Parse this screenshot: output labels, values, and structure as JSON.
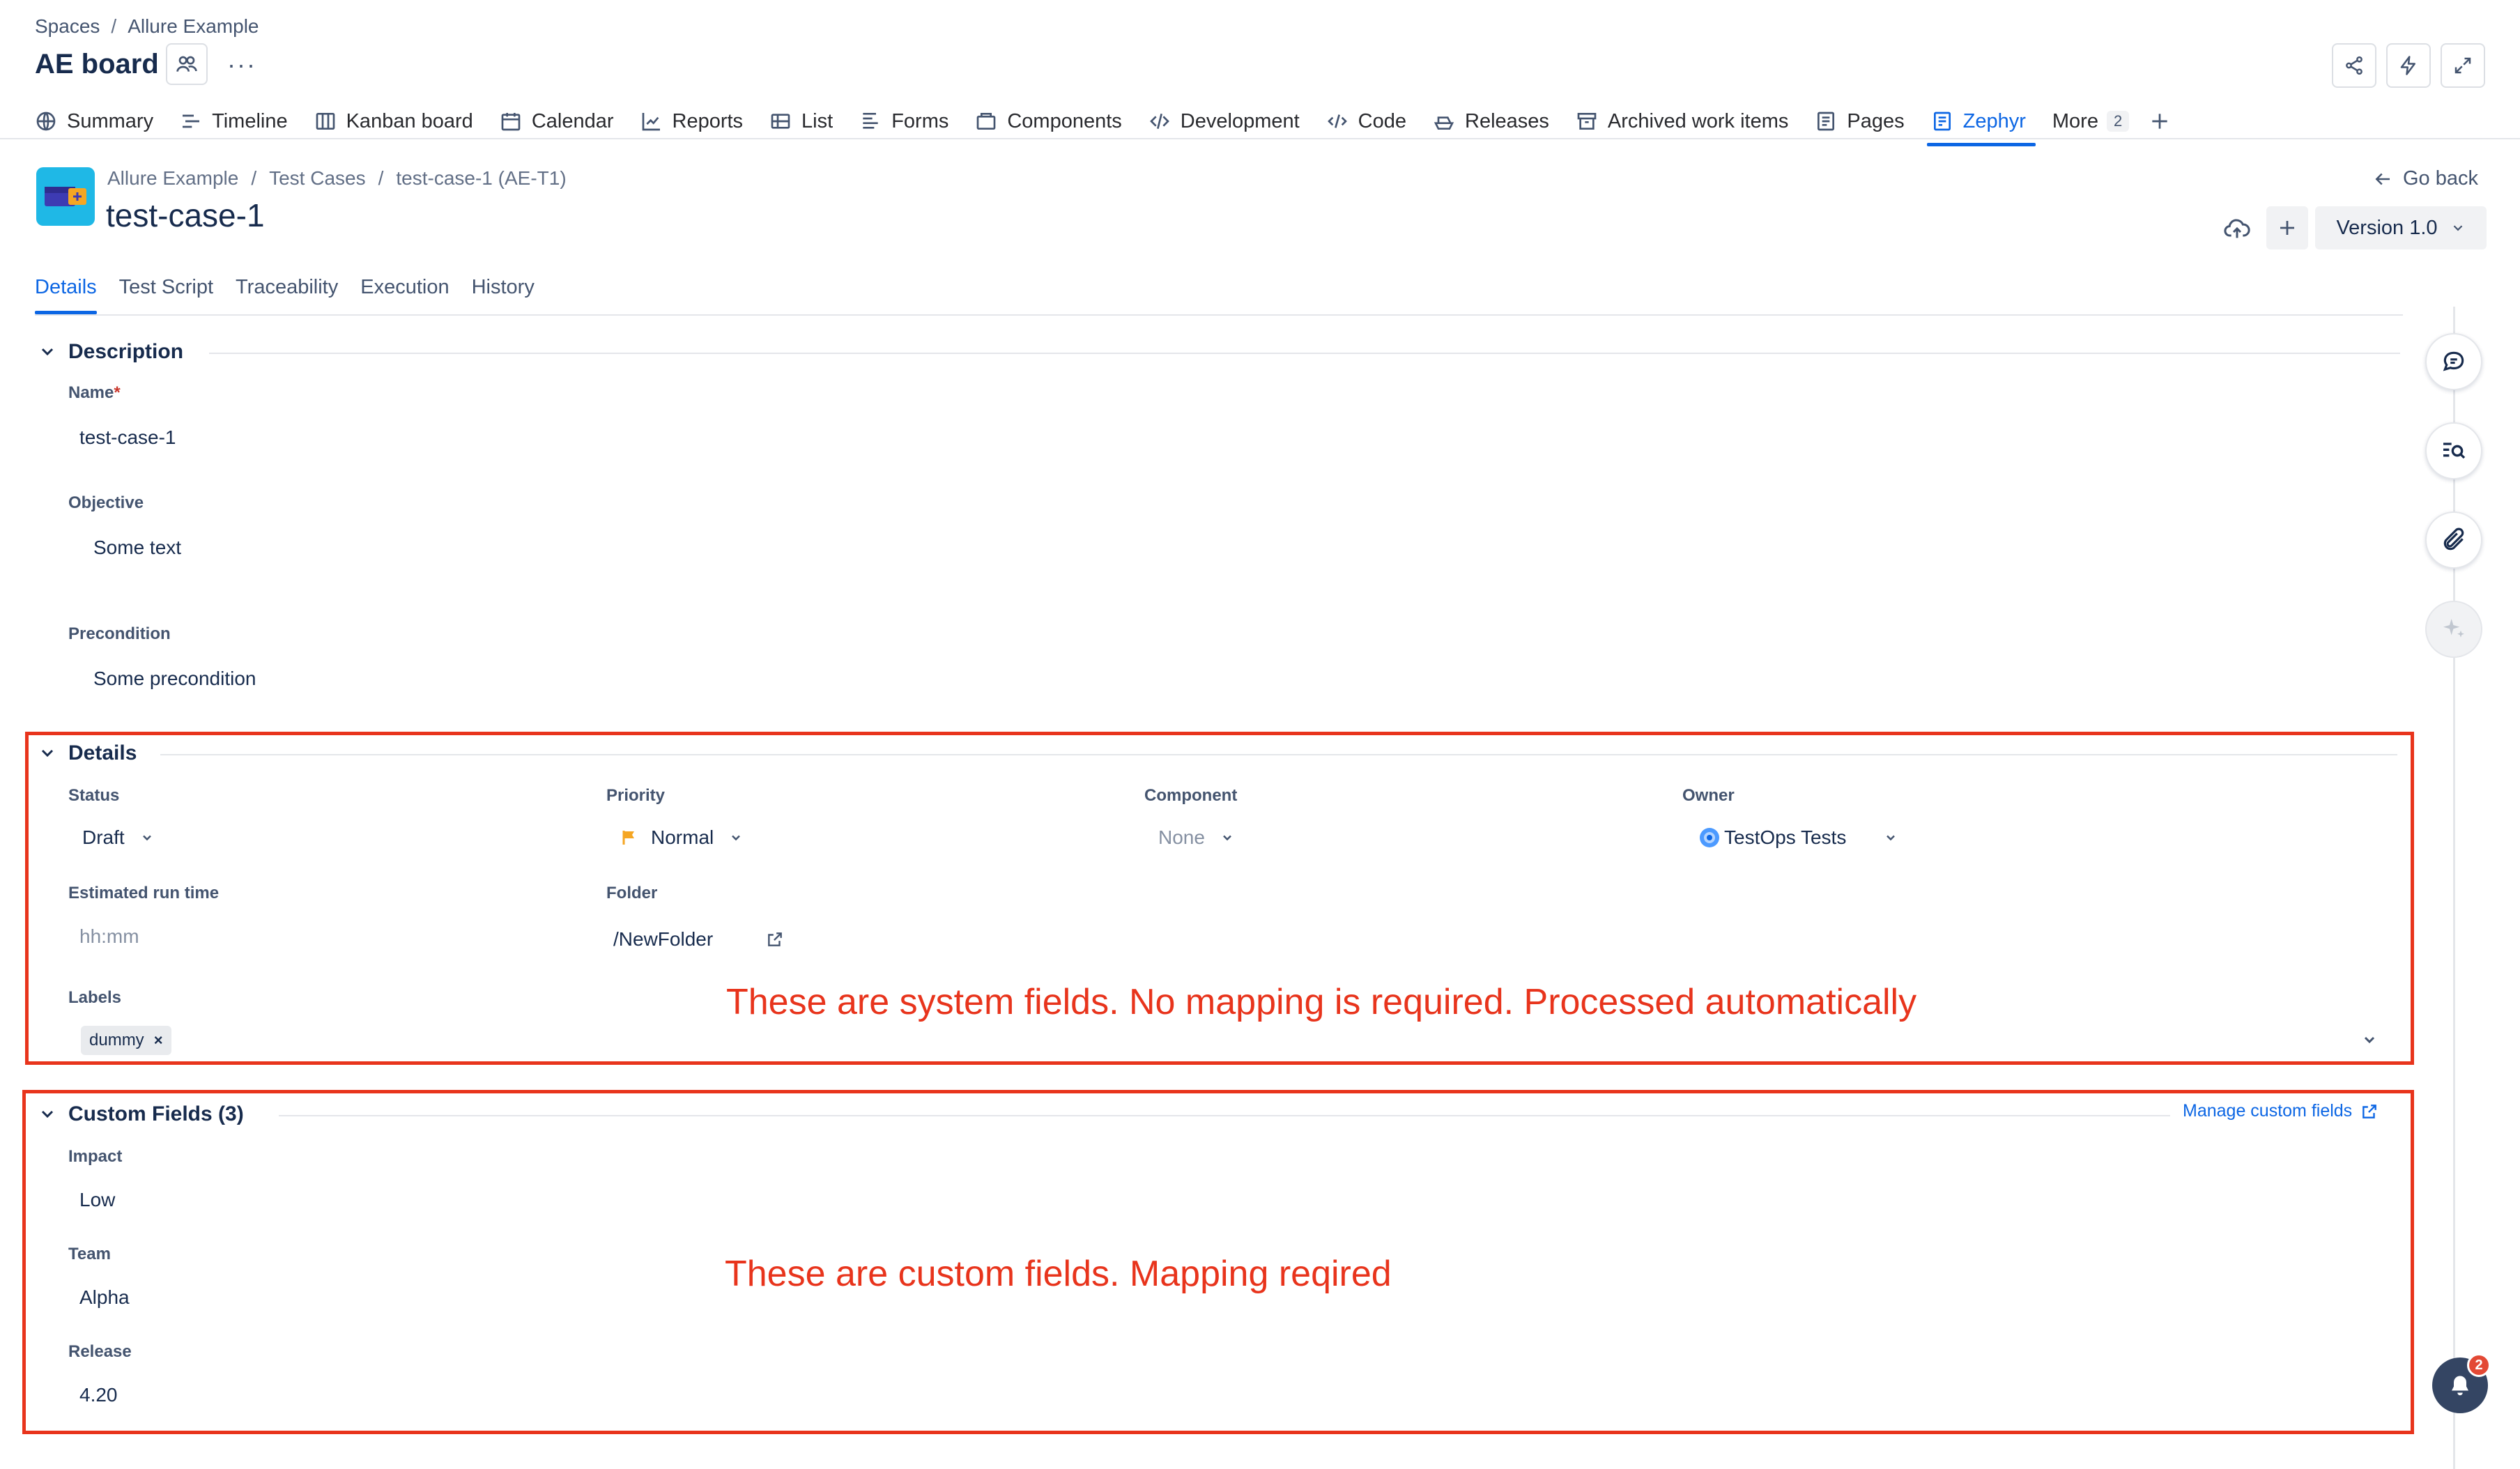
{
  "header": {
    "breadcrumb": [
      "Spaces",
      "Allure Example"
    ],
    "board_title": "AE board",
    "more": "···"
  },
  "nav": {
    "items": [
      {
        "label": "Summary",
        "icon": "globe-icon"
      },
      {
        "label": "Timeline",
        "icon": "timeline-icon"
      },
      {
        "label": "Kanban board",
        "icon": "board-icon"
      },
      {
        "label": "Calendar",
        "icon": "calendar-icon"
      },
      {
        "label": "Reports",
        "icon": "chart-icon"
      },
      {
        "label": "List",
        "icon": "list-icon"
      },
      {
        "label": "Forms",
        "icon": "forms-icon"
      },
      {
        "label": "Components",
        "icon": "components-icon"
      },
      {
        "label": "Development",
        "icon": "development-icon"
      },
      {
        "label": "Code",
        "icon": "code-icon"
      },
      {
        "label": "Releases",
        "icon": "ship-icon"
      },
      {
        "label": "Archived work items",
        "icon": "archive-icon"
      },
      {
        "label": "Pages",
        "icon": "page-icon"
      },
      {
        "label": "Zephyr",
        "icon": "zephyr-icon"
      }
    ],
    "active": "Zephyr",
    "more_label": "More",
    "more_count": "2"
  },
  "testcase": {
    "breadcrumb": [
      "Allure Example",
      "Test Cases",
      "test-case-1 (AE-T1)"
    ],
    "title": "test-case-1",
    "go_back": "Go back",
    "version": "Version 1.0"
  },
  "tabs": [
    "Details",
    "Test Script",
    "Traceability",
    "Execution",
    "History"
  ],
  "description": {
    "heading": "Description",
    "name_label": "Name",
    "name_required": "*",
    "name_value": "test-case-1",
    "objective_label": "Objective",
    "objective_value": "Some text",
    "precondition_label": "Precondition",
    "precondition_value": "Some precondition"
  },
  "details": {
    "heading": "Details",
    "status_label": "Status",
    "status_value": "Draft",
    "priority_label": "Priority",
    "priority_value": "Normal",
    "component_label": "Component",
    "component_value": "None",
    "owner_label": "Owner",
    "owner_value": "TestOps Tests",
    "estimated_label": "Estimated run time",
    "estimated_placeholder": "hh:mm",
    "folder_label": "Folder",
    "folder_value": "/NewFolder",
    "labels_label": "Labels",
    "labels": [
      "dummy"
    ],
    "annotation": "These are system fields. No mapping is required. Processed automatically"
  },
  "custom_fields": {
    "heading": "Custom Fields (3)",
    "manage_link": "Manage custom fields",
    "impact_label": "Impact",
    "impact_value": "Low",
    "team_label": "Team",
    "team_value": "Alpha",
    "release_label": "Release",
    "release_value": "4.20",
    "annotation": "These are custom fields. Mapping reqired"
  },
  "notifications": {
    "count": "2"
  },
  "colors": {
    "accent": "#0c66e4",
    "annotation_red": "#e8341c",
    "priority_flag": "#f5a623"
  }
}
